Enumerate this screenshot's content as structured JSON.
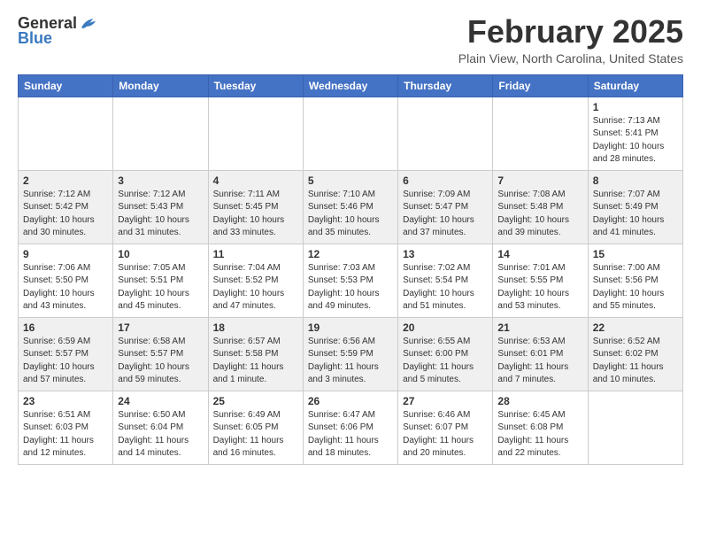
{
  "header": {
    "logo_general": "General",
    "logo_blue": "Blue",
    "month_title": "February 2025",
    "location": "Plain View, North Carolina, United States"
  },
  "days_of_week": [
    "Sunday",
    "Monday",
    "Tuesday",
    "Wednesday",
    "Thursday",
    "Friday",
    "Saturday"
  ],
  "weeks": [
    {
      "days": [
        {
          "num": "",
          "info": ""
        },
        {
          "num": "",
          "info": ""
        },
        {
          "num": "",
          "info": ""
        },
        {
          "num": "",
          "info": ""
        },
        {
          "num": "",
          "info": ""
        },
        {
          "num": "",
          "info": ""
        },
        {
          "num": "1",
          "info": "Sunrise: 7:13 AM\nSunset: 5:41 PM\nDaylight: 10 hours\nand 28 minutes."
        }
      ]
    },
    {
      "days": [
        {
          "num": "2",
          "info": "Sunrise: 7:12 AM\nSunset: 5:42 PM\nDaylight: 10 hours\nand 30 minutes."
        },
        {
          "num": "3",
          "info": "Sunrise: 7:12 AM\nSunset: 5:43 PM\nDaylight: 10 hours\nand 31 minutes."
        },
        {
          "num": "4",
          "info": "Sunrise: 7:11 AM\nSunset: 5:45 PM\nDaylight: 10 hours\nand 33 minutes."
        },
        {
          "num": "5",
          "info": "Sunrise: 7:10 AM\nSunset: 5:46 PM\nDaylight: 10 hours\nand 35 minutes."
        },
        {
          "num": "6",
          "info": "Sunrise: 7:09 AM\nSunset: 5:47 PM\nDaylight: 10 hours\nand 37 minutes."
        },
        {
          "num": "7",
          "info": "Sunrise: 7:08 AM\nSunset: 5:48 PM\nDaylight: 10 hours\nand 39 minutes."
        },
        {
          "num": "8",
          "info": "Sunrise: 7:07 AM\nSunset: 5:49 PM\nDaylight: 10 hours\nand 41 minutes."
        }
      ]
    },
    {
      "days": [
        {
          "num": "9",
          "info": "Sunrise: 7:06 AM\nSunset: 5:50 PM\nDaylight: 10 hours\nand 43 minutes."
        },
        {
          "num": "10",
          "info": "Sunrise: 7:05 AM\nSunset: 5:51 PM\nDaylight: 10 hours\nand 45 minutes."
        },
        {
          "num": "11",
          "info": "Sunrise: 7:04 AM\nSunset: 5:52 PM\nDaylight: 10 hours\nand 47 minutes."
        },
        {
          "num": "12",
          "info": "Sunrise: 7:03 AM\nSunset: 5:53 PM\nDaylight: 10 hours\nand 49 minutes."
        },
        {
          "num": "13",
          "info": "Sunrise: 7:02 AM\nSunset: 5:54 PM\nDaylight: 10 hours\nand 51 minutes."
        },
        {
          "num": "14",
          "info": "Sunrise: 7:01 AM\nSunset: 5:55 PM\nDaylight: 10 hours\nand 53 minutes."
        },
        {
          "num": "15",
          "info": "Sunrise: 7:00 AM\nSunset: 5:56 PM\nDaylight: 10 hours\nand 55 minutes."
        }
      ]
    },
    {
      "days": [
        {
          "num": "16",
          "info": "Sunrise: 6:59 AM\nSunset: 5:57 PM\nDaylight: 10 hours\nand 57 minutes."
        },
        {
          "num": "17",
          "info": "Sunrise: 6:58 AM\nSunset: 5:57 PM\nDaylight: 10 hours\nand 59 minutes."
        },
        {
          "num": "18",
          "info": "Sunrise: 6:57 AM\nSunset: 5:58 PM\nDaylight: 11 hours\nand 1 minute."
        },
        {
          "num": "19",
          "info": "Sunrise: 6:56 AM\nSunset: 5:59 PM\nDaylight: 11 hours\nand 3 minutes."
        },
        {
          "num": "20",
          "info": "Sunrise: 6:55 AM\nSunset: 6:00 PM\nDaylight: 11 hours\nand 5 minutes."
        },
        {
          "num": "21",
          "info": "Sunrise: 6:53 AM\nSunset: 6:01 PM\nDaylight: 11 hours\nand 7 minutes."
        },
        {
          "num": "22",
          "info": "Sunrise: 6:52 AM\nSunset: 6:02 PM\nDaylight: 11 hours\nand 10 minutes."
        }
      ]
    },
    {
      "days": [
        {
          "num": "23",
          "info": "Sunrise: 6:51 AM\nSunset: 6:03 PM\nDaylight: 11 hours\nand 12 minutes."
        },
        {
          "num": "24",
          "info": "Sunrise: 6:50 AM\nSunset: 6:04 PM\nDaylight: 11 hours\nand 14 minutes."
        },
        {
          "num": "25",
          "info": "Sunrise: 6:49 AM\nSunset: 6:05 PM\nDaylight: 11 hours\nand 16 minutes."
        },
        {
          "num": "26",
          "info": "Sunrise: 6:47 AM\nSunset: 6:06 PM\nDaylight: 11 hours\nand 18 minutes."
        },
        {
          "num": "27",
          "info": "Sunrise: 6:46 AM\nSunset: 6:07 PM\nDaylight: 11 hours\nand 20 minutes."
        },
        {
          "num": "28",
          "info": "Sunrise: 6:45 AM\nSunset: 6:08 PM\nDaylight: 11 hours\nand 22 minutes."
        },
        {
          "num": "",
          "info": ""
        }
      ]
    }
  ]
}
